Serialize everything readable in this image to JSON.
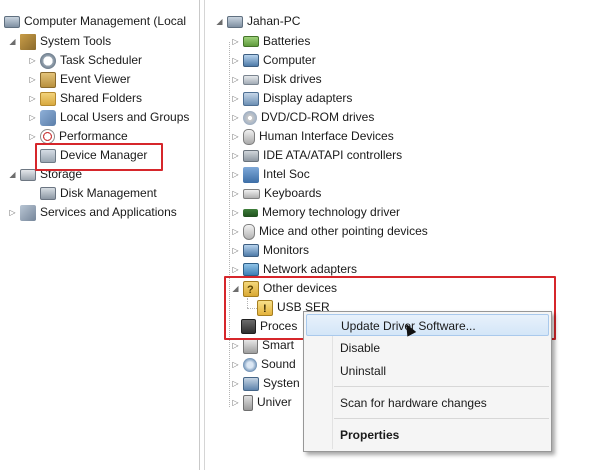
{
  "left_tree": {
    "root": "Computer Management (Local",
    "system_tools": "System Tools",
    "task_scheduler": "Task Scheduler",
    "event_viewer": "Event Viewer",
    "shared_folders": "Shared Folders",
    "local_users": "Local Users and Groups",
    "performance": "Performance",
    "device_manager": "Device Manager",
    "storage": "Storage",
    "disk_management": "Disk Management",
    "services_apps": "Services and Applications"
  },
  "right_tree": {
    "root": "Jahan-PC",
    "items": [
      "Batteries",
      "Computer",
      "Disk drives",
      "Display adapters",
      "DVD/CD-ROM drives",
      "Human Interface Devices",
      "IDE ATA/ATAPI controllers",
      "Intel Soc",
      "Keyboards",
      "Memory technology driver",
      "Mice and other pointing devices",
      "Monitors",
      "Network adapters",
      "Other devices"
    ],
    "other_child": "USB SER",
    "partial_items": [
      "Proces",
      "Smart",
      "Sound",
      "Systen",
      "Univer"
    ]
  },
  "context_menu": {
    "update_driver": "Update Driver Software...",
    "disable": "Disable",
    "uninstall": "Uninstall",
    "scan": "Scan for hardware changes",
    "properties": "Properties"
  },
  "colors": {
    "highlight_box": "#d6262b",
    "menu_hover": "#d4e6f8"
  }
}
